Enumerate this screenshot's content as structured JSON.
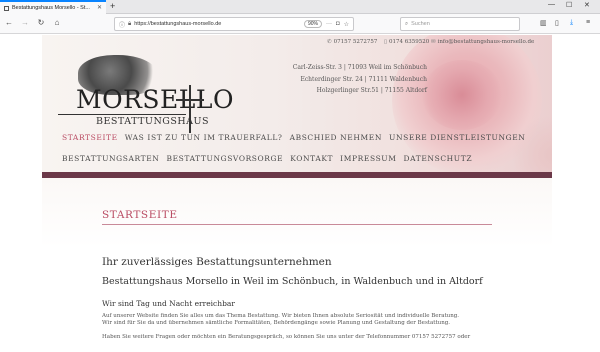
{
  "browser": {
    "tab_title": "Bestattungshaus Morsello - St...",
    "new_tab": "+",
    "url": "https://bestattungshaus-morsello.de",
    "zoom": "90%",
    "search_placeholder": "Suchen",
    "window_controls": [
      "—",
      "☐",
      "✕"
    ]
  },
  "header": {
    "phone": "07157 5272757",
    "mobile": "0174 6359520",
    "email": "info@bestattungshaus-morsello.de",
    "addresses": [
      "Carl-Zeiss-Str. 3 | 71093 Weil im Schönbuch",
      "Echterdinger Str. 24 | 71111 Waldenbuch",
      "Holzgerlinger Str.51 | 71155 Altdorf"
    ],
    "logo_name": "MORSELLO",
    "logo_sub": "BESTATTUNGSHAUS"
  },
  "menu_row1": [
    "Startseite",
    "Was ist zu tun im Trauerfall?",
    "Abschied nehmen",
    "Unsere Dienstleistungen"
  ],
  "menu_row2": [
    "Bestattungsarten",
    "Bestattungsvorsorge",
    "Kontakt",
    "Impressum",
    "Datenschutz"
  ],
  "content": {
    "page_title": "Startseite",
    "heading": "Ihr zuverlässiges Bestattungsunternehmen",
    "subheading": "Bestattungshaus Morsello in Weil im Schönbuch, in Waldenbuch und in Altdorf",
    "availability": "Wir sind Tag und Nacht erreichbar",
    "para1_line1": "Auf unserer Website finden Sie alles um das Thema Bestattung. Wir bieten Ihnen absolute Seriosität und individuelle Beratung.",
    "para1_line2": "Wir sind für Sie da und übernehmen sämtliche Formalitäten, Behördengänge sowie Planung und Gestaltung der Bestattung.",
    "para2_line1": "Haben Sie weitere Fragen oder möchten ein Beratungsgespräch, so können Sie uns unter der Telefonnummer 07157 5272757 oder"
  }
}
